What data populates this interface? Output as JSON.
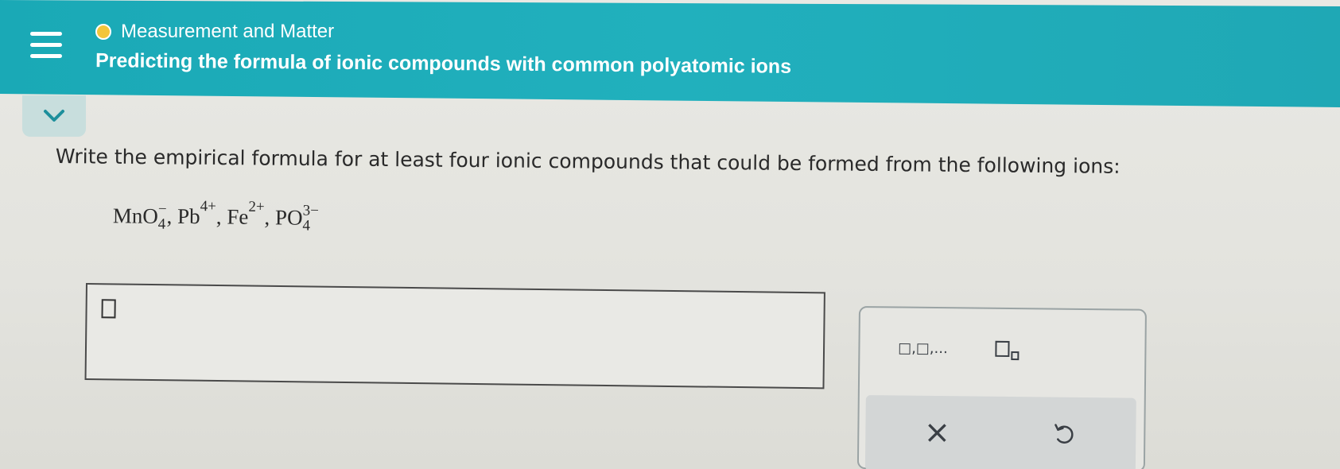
{
  "header": {
    "topic": "Measurement and Matter",
    "title": "Predicting the formula of ionic compounds with common polyatomic ions",
    "background_color": "#1fabb8",
    "status_dot_color": "#f3c53a"
  },
  "question": {
    "prompt": "Write the empirical formula for at least four ionic compounds that could be formed from the following ions:",
    "ions": [
      {
        "base": "MnO",
        "sub": "4",
        "sup": "−"
      },
      {
        "base": "Pb",
        "sub": "",
        "sup": "4+"
      },
      {
        "base": "Fe",
        "sub": "",
        "sup": "2+"
      },
      {
        "base": "PO",
        "sub": "4",
        "sup": "3−"
      }
    ],
    "separator": ","
  },
  "answer": {
    "value": ""
  },
  "keypad": {
    "list_label": "□,□,...",
    "subscript_icon": "subscript-template-icon",
    "clear_label": "×",
    "undo_icon": "undo-icon"
  }
}
